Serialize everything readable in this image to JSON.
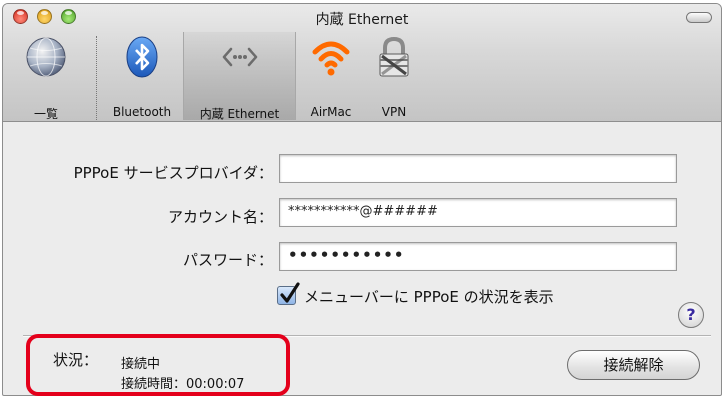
{
  "window": {
    "title": "内蔵 Ethernet"
  },
  "toolbar": {
    "items": [
      {
        "label": "一覧",
        "icon": "globe-icon"
      },
      {
        "label": "Bluetooth",
        "icon": "bluetooth-icon"
      },
      {
        "label": "内蔵 Ethernet",
        "icon": "ethernet-icon",
        "selected": true
      },
      {
        "label": "AirMac",
        "icon": "airmac-icon"
      },
      {
        "label": "VPN",
        "icon": "lock-icon"
      }
    ]
  },
  "form": {
    "provider_label": "PPPoE サービスプロバイダ：",
    "provider_value": "",
    "account_label": "アカウント名：",
    "account_value": "***********@######",
    "password_label": "パスワード：",
    "password_value": "•••••••••••",
    "show_status_label": "メニューバーに PPPoE の状況を表示",
    "show_status_checked": true
  },
  "help": {
    "label": "?"
  },
  "status": {
    "label": "状況：",
    "value": "接続中",
    "time": "接続時間：00:00:07"
  },
  "actions": {
    "disconnect_label": "接続解除"
  },
  "colors": {
    "highlight": "#e4001b",
    "airmac": "#ff6a00",
    "bluetooth": "#1e6fd6"
  }
}
